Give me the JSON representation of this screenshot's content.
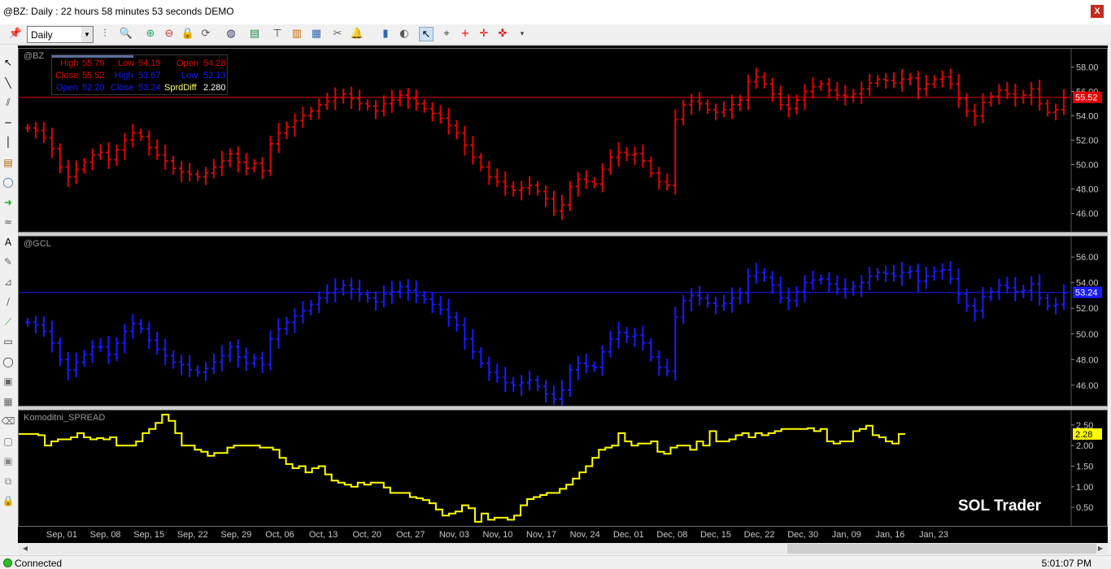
{
  "window": {
    "title": "@BZ: Daily : 22 hours 58 minutes 53 seconds DEMO",
    "close_glyph": "X"
  },
  "toolbar": {
    "interval": "Daily",
    "icons": [
      "pushpin-icon",
      "interval-select",
      "bar-style-icon",
      "zoom-menu-icon",
      "zoom-in-icon",
      "zoom-out-icon",
      "lock-icon",
      "refresh-icon",
      "globe-icon",
      "chart-type-icon",
      "hierarchy-icon",
      "bar-colors-icon",
      "properties-icon",
      "alert-bell-icon",
      "notebook-icon",
      "chat-icon",
      "pointer-icon",
      "crosshair-icon",
      "cross-red-icon",
      "cross-star-icon",
      "cross-arrow-icon",
      "overflow-icon"
    ]
  },
  "drawing_tools": [
    "pointer-tool",
    "line-tool",
    "channel-tool",
    "hline-tool",
    "vline-tool",
    "note-tool",
    "callout-tool",
    "arrow-tool",
    "wave-tool",
    "text-tool",
    "pen-tool",
    "fib-tool",
    "gann-tool",
    "regression-tool",
    "rectangle-tool",
    "ellipse-tool",
    "template-tool",
    "layout-tool",
    "eraser-tool",
    "magnet-tool",
    "group-tool",
    "layers-tool",
    "lock-tool"
  ],
  "chart_data": [
    {
      "type": "ohlc",
      "symbol": "@BZ",
      "color": "#e60000",
      "last_price": "55.52",
      "y_ticks": [
        "58.00",
        "56.00",
        "54.00",
        "52.00",
        "50.00",
        "48.00",
        "46.00"
      ],
      "ylim": [
        44.5,
        59.5
      ],
      "closes": [
        53.0,
        52.8,
        52.2,
        51.3,
        49.8,
        49.0,
        49.6,
        50.2,
        50.8,
        51.0,
        50.4,
        51.2,
        52.0,
        52.6,
        52.3,
        51.4,
        50.8,
        50.3,
        49.7,
        49.4,
        49.2,
        49.0,
        49.3,
        49.8,
        50.3,
        50.9,
        50.2,
        49.7,
        50.1,
        49.5,
        51.7,
        52.6,
        53.1,
        53.6,
        54.0,
        54.4,
        54.9,
        55.2,
        55.5,
        55.8,
        55.4,
        55.0,
        54.8,
        54.4,
        55.0,
        55.3,
        55.7,
        55.4,
        55.0,
        54.6,
        54.2,
        53.8,
        53.2,
        52.6,
        51.6,
        50.6,
        49.8,
        49.0,
        48.6,
        48.2,
        47.9,
        48.1,
        48.3,
        47.8,
        47.2,
        46.2,
        46.7,
        48.2,
        48.8,
        48.6,
        48.4,
        49.6,
        50.6,
        51.0,
        50.8,
        50.9,
        50.3,
        49.3,
        48.6,
        48.3,
        53.7,
        54.9,
        55.2,
        55.0,
        54.5,
        54.3,
        54.5,
        54.9,
        55.3,
        56.8,
        57.2,
        56.6,
        55.8,
        54.9,
        54.6,
        55.3,
        56.0,
        56.4,
        56.6,
        56.1,
        55.7,
        55.6,
        55.8,
        56.2,
        56.7,
        57.0,
        56.9,
        56.7,
        57.0,
        57.1,
        56.2,
        56.6,
        57.0,
        57.2,
        56.6,
        55.4,
        54.4,
        54.0,
        55.1,
        55.6,
        56.1,
        55.8,
        55.5,
        55.7,
        56.2,
        55.0,
        54.3,
        54.5,
        55.5
      ],
      "x_labels": [
        "Sep, 01",
        "Sep, 08",
        "Sep, 15",
        "Sep, 22",
        "Sep, 29",
        "Oct, 06",
        "Oct, 13",
        "Oct, 20",
        "Oct, 27",
        "Nov, 03",
        "Nov, 10",
        "Nov, 17",
        "Nov, 24",
        "Dec, 01",
        "Dec, 08",
        "Dec, 15",
        "Dec, 22",
        "Dec, 30",
        "Jan, 09",
        "Jan, 16",
        "Jan, 23"
      ]
    },
    {
      "type": "ohlc",
      "symbol": "@GCL",
      "color": "#1a1aff",
      "last_price": "53.24",
      "y_ticks": [
        "56.00",
        "54.00",
        "52.00",
        "50.00",
        "48.00",
        "46.00"
      ],
      "ylim": [
        44.4,
        57.6
      ],
      "closes": [
        50.9,
        50.7,
        50.2,
        49.3,
        48.0,
        47.2,
        47.8,
        48.4,
        49.0,
        49.0,
        48.4,
        49.3,
        50.2,
        50.8,
        50.4,
        49.5,
        48.8,
        48.3,
        47.8,
        47.6,
        47.2,
        47.0,
        47.3,
        47.8,
        48.3,
        49.0,
        48.2,
        47.7,
        48.1,
        47.6,
        49.6,
        50.4,
        50.9,
        51.4,
        51.8,
        52.3,
        52.8,
        53.2,
        53.5,
        53.8,
        53.5,
        53.1,
        52.8,
        52.5,
        53.1,
        53.3,
        53.7,
        53.4,
        53.0,
        52.7,
        52.3,
        51.9,
        51.3,
        50.7,
        49.6,
        48.6,
        47.7,
        47.0,
        46.6,
        46.2,
        46.0,
        46.2,
        46.4,
        45.9,
        45.3,
        44.9,
        45.6,
        47.2,
        47.7,
        47.5,
        47.4,
        48.6,
        49.6,
        50.1,
        49.8,
        49.9,
        49.3,
        48.2,
        47.4,
        47.1,
        51.3,
        52.6,
        53.0,
        52.8,
        52.4,
        52.2,
        52.4,
        52.8,
        53.2,
        54.5,
        54.8,
        54.4,
        53.8,
        52.8,
        52.6,
        53.3,
        54.0,
        54.2,
        54.3,
        53.9,
        53.5,
        53.5,
        53.7,
        54.0,
        54.5,
        54.8,
        54.7,
        54.5,
        54.8,
        54.9,
        54.1,
        54.5,
        54.9,
        55.0,
        54.3,
        53.1,
        52.2,
        51.8,
        52.9,
        53.3,
        53.8,
        53.6,
        53.3,
        53.4,
        53.9,
        52.8,
        52.2,
        52.3,
        53.2
      ]
    },
    {
      "type": "line",
      "name": "Komoditni_SPREAD",
      "color": "#ffff00",
      "last_value": "2.28",
      "y_ticks": [
        "2.50",
        "2.00",
        "1.50",
        "1.00",
        "0.50"
      ],
      "ylim": [
        0.05,
        2.85
      ],
      "values": [
        2.28,
        2.28,
        2.28,
        2.25,
        2.0,
        2.1,
        2.15,
        2.15,
        2.2,
        2.3,
        2.2,
        2.15,
        2.18,
        2.15,
        2.2,
        2.0,
        2.0,
        2.0,
        2.1,
        2.3,
        2.4,
        2.55,
        2.75,
        2.6,
        2.3,
        2.0,
        2.0,
        1.9,
        1.85,
        1.75,
        1.82,
        1.82,
        1.95,
        2.0,
        2.0,
        2.0,
        2.0,
        1.95,
        1.95,
        1.9,
        1.7,
        1.55,
        1.45,
        1.5,
        1.35,
        1.45,
        1.5,
        1.3,
        1.15,
        1.1,
        1.05,
        1.0,
        1.1,
        1.05,
        1.1,
        1.1,
        0.98,
        0.85,
        0.85,
        0.85,
        0.75,
        0.72,
        0.68,
        0.6,
        0.45,
        0.3,
        0.35,
        0.4,
        0.55,
        0.48,
        0.15,
        0.35,
        0.2,
        0.25,
        0.25,
        0.2,
        0.3,
        0.55,
        0.7,
        0.75,
        0.8,
        0.85,
        0.85,
        0.95,
        1.05,
        1.2,
        1.35,
        1.5,
        1.7,
        1.9,
        1.95,
        2.0,
        2.3,
        2.1,
        2.0,
        2.05,
        2.05,
        2.1,
        1.85,
        1.8,
        1.95,
        2.0,
        2.0,
        1.9,
        2.1,
        2.0,
        2.35,
        2.1,
        2.1,
        2.15,
        2.25,
        2.3,
        2.2,
        2.3,
        2.25,
        2.3,
        2.35,
        2.4,
        2.4,
        2.4,
        2.4,
        2.42,
        2.35,
        2.4,
        2.1,
        2.05,
        2.1,
        2.1,
        2.35,
        2.4,
        2.48,
        2.25,
        2.2,
        2.1,
        2.05,
        2.28
      ]
    }
  ],
  "infobox": {
    "row1": {
      "l1": "High",
      "v1": "55.79",
      "l2": "Low",
      "v2": "54.19",
      "l3": "Open",
      "v3": "54.28"
    },
    "row2": {
      "l1": "Close",
      "v1": "55.52",
      "l2": "High",
      "v2": "53.67",
      "l3": "Low",
      "v3": "52.13"
    },
    "row3": {
      "l1": "Open",
      "v1": "52.20",
      "l2": "Close",
      "v2": "53.24",
      "l3": "SprdDiff",
      "v3": "2.280"
    }
  },
  "watermark": "SOL Trader",
  "status": {
    "text": "Connected",
    "time": "5:01:07 PM"
  },
  "colors": {
    "price1": "#e60000",
    "price2": "#1a1aff",
    "spread": "#ffff00",
    "last1_bg": "#e60000",
    "last2_bg": "#1a1aff",
    "last3_bg": "#ffff00"
  }
}
